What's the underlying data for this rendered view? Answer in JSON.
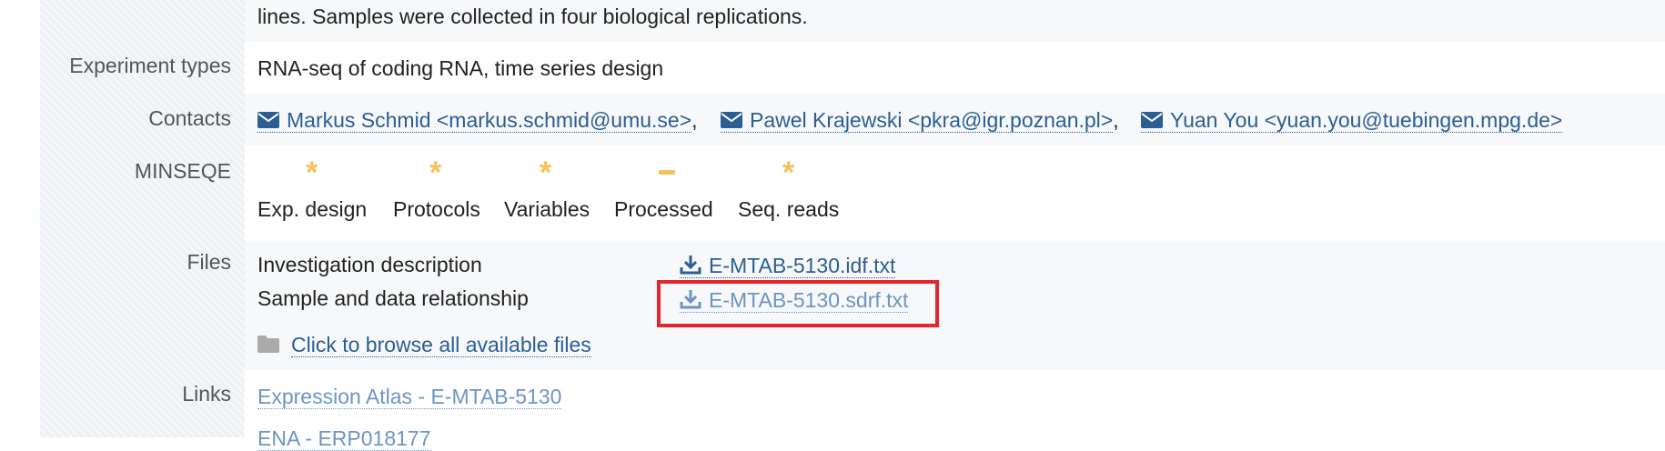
{
  "description_tail": "lines. Samples were collected in four biological replications.",
  "labels": {
    "experiment_types": "Experiment types",
    "contacts": "Contacts",
    "minseqe": "MINSEQE",
    "files": "Files",
    "links": "Links"
  },
  "experiment_types": "RNA-seq of coding RNA, time series design",
  "contacts": [
    {
      "text": "Markus Schmid <markus.schmid@umu.se>"
    },
    {
      "text": "Pawel Krajewski <pkra@igr.poznan.pl>"
    },
    {
      "text": "Yuan You <yuan.you@tuebingen.mpg.de>"
    }
  ],
  "contact_separator": ",",
  "minseqe": [
    {
      "symbol": "*",
      "label": "Exp. design"
    },
    {
      "symbol": "*",
      "label": "Protocols"
    },
    {
      "symbol": "*",
      "label": "Variables"
    },
    {
      "symbol": "-",
      "label": "Processed"
    },
    {
      "symbol": "*",
      "label": "Seq. reads"
    }
  ],
  "files": {
    "idf_label": "Investigation description",
    "idf_file": "E-MTAB-5130.idf.txt",
    "sdrf_label": "Sample and data relationship",
    "sdrf_file": "E-MTAB-5130.sdrf.txt",
    "browse": "Click to browse all available files"
  },
  "links": [
    {
      "text": "Expression Atlas - E-MTAB-5130"
    },
    {
      "text": "ENA - ERP018177"
    }
  ],
  "colors": {
    "link": "#2c5e93",
    "link_visited": "#6d95c4",
    "minseqe_star": "#f5c35c",
    "highlight": "#e8242b"
  }
}
